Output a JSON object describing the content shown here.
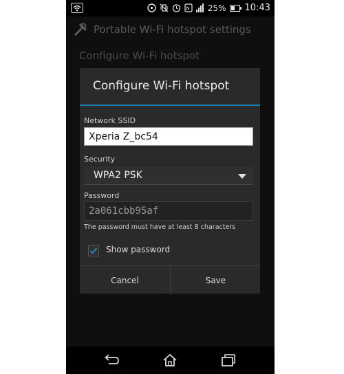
{
  "status_bar": {
    "battery": "25%",
    "time": "10:43"
  },
  "background": {
    "title": "Portable Wi-Fi hotspot settings",
    "item_title": "Configure Wi-Fi hotspot"
  },
  "dialog": {
    "title": "Configure Wi-Fi hotspot",
    "ssid_label": "Network SSID",
    "ssid_value": "Xperia Z_bc54",
    "security_label": "Security",
    "security_value": "WPA2 PSK",
    "password_label": "Password",
    "password_value": "2a061cbb95af",
    "password_hint": "The password must have at least 8 characters",
    "show_password_label": "Show password",
    "show_password_checked": true,
    "cancel_label": "Cancel",
    "save_label": "Save"
  },
  "colors": {
    "accent": "#1e7bb0",
    "dialog_bg": "#2a2a2a"
  }
}
